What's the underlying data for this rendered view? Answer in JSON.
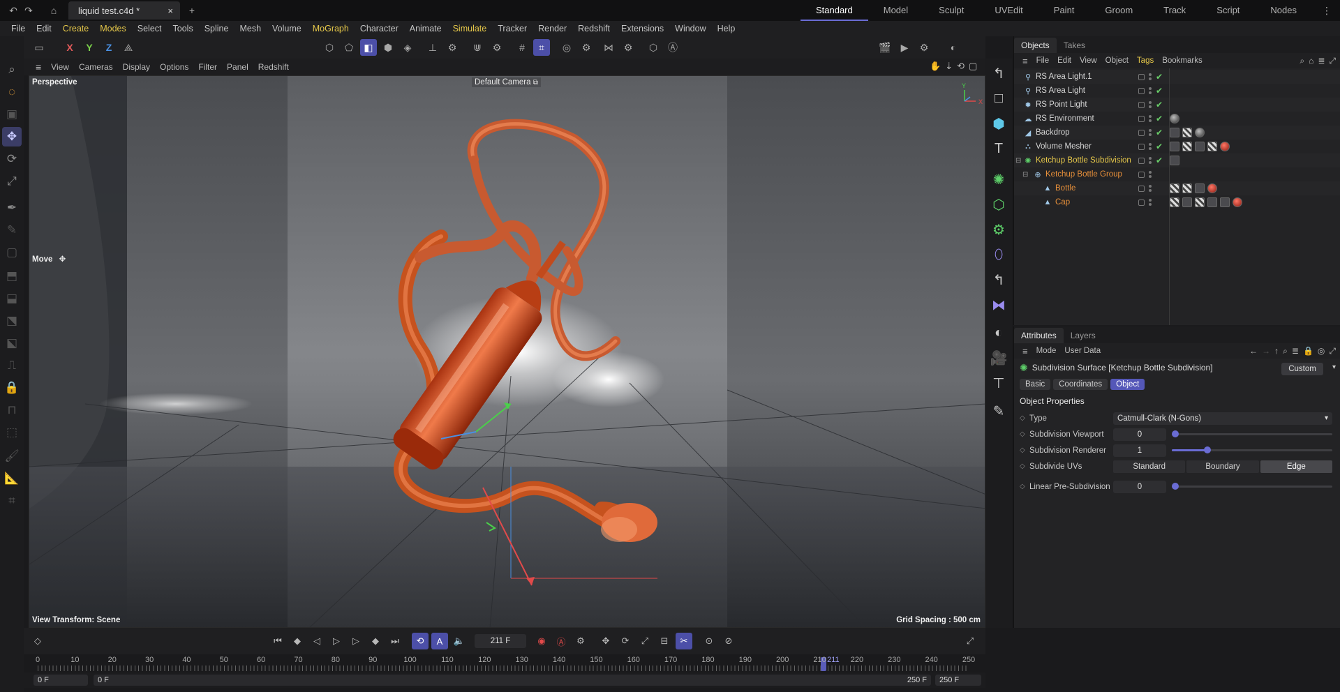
{
  "titlebar": {
    "document_tab": "liquid test.c4d *",
    "close_glyph": "×",
    "new_tab_glyph": "+",
    "layouts": [
      "Standard",
      "Model",
      "Sculpt",
      "UVEdit",
      "Paint",
      "Groom",
      "Track",
      "Script",
      "Nodes"
    ],
    "active_layout": "Standard"
  },
  "menubar": {
    "items": [
      {
        "label": "File",
        "highlight": false
      },
      {
        "label": "Edit",
        "highlight": false
      },
      {
        "label": "Create",
        "highlight": true
      },
      {
        "label": "Modes",
        "highlight": true
      },
      {
        "label": "Select",
        "highlight": false
      },
      {
        "label": "Tools",
        "highlight": false
      },
      {
        "label": "Spline",
        "highlight": false
      },
      {
        "label": "Mesh",
        "highlight": false
      },
      {
        "label": "Volume",
        "highlight": false
      },
      {
        "label": "MoGraph",
        "highlight": true
      },
      {
        "label": "Character",
        "highlight": false
      },
      {
        "label": "Animate",
        "highlight": false
      },
      {
        "label": "Simulate",
        "highlight": true
      },
      {
        "label": "Tracker",
        "highlight": false
      },
      {
        "label": "Render",
        "highlight": false
      },
      {
        "label": "Redshift",
        "highlight": false
      },
      {
        "label": "Extensions",
        "highlight": false
      },
      {
        "label": "Window",
        "highlight": false
      },
      {
        "label": "Help",
        "highlight": false
      }
    ]
  },
  "toolbar": {
    "axis_x": "X",
    "axis_y": "Y",
    "axis_z": "Z"
  },
  "viewport": {
    "menu": [
      "View",
      "Cameras",
      "Display",
      "Options",
      "Filter",
      "Panel",
      "Redshift"
    ],
    "projection": "Perspective",
    "camera": "Default Camera",
    "tool_name": "Move",
    "view_transform": "View Transform: Scene",
    "grid_spacing": "Grid Spacing : 500 cm",
    "axis_y_label": "Y",
    "axis_x_label": "X"
  },
  "objects_panel": {
    "tabs": [
      "Objects",
      "Takes"
    ],
    "menu": [
      {
        "label": "File",
        "highlight": false
      },
      {
        "label": "Edit",
        "highlight": false
      },
      {
        "label": "View",
        "highlight": false
      },
      {
        "label": "Object",
        "highlight": false
      },
      {
        "label": "Tags",
        "highlight": true
      },
      {
        "label": "Bookmarks",
        "highlight": false
      }
    ],
    "objects": [
      {
        "name": "RS Area Light.1",
        "indent": 0,
        "color": "default",
        "icon": "light-icon",
        "checked": true,
        "tags": []
      },
      {
        "name": "RS Area Light",
        "indent": 0,
        "color": "default",
        "icon": "light-icon",
        "checked": true,
        "tags": []
      },
      {
        "name": "RS Point Light",
        "indent": 0,
        "color": "default",
        "icon": "point-light-icon",
        "checked": true,
        "tags": []
      },
      {
        "name": "RS Environment",
        "indent": 0,
        "color": "default",
        "icon": "environment-icon",
        "checked": true,
        "tags": [
          "gray"
        ]
      },
      {
        "name": "Backdrop",
        "indent": 0,
        "color": "default",
        "icon": "backdrop-icon",
        "checked": true,
        "tags": [
          "plain",
          "checker",
          "gray"
        ]
      },
      {
        "name": "Volume Mesher",
        "indent": 0,
        "color": "default",
        "icon": "volume-mesher-icon",
        "checked": true,
        "tags": [
          "plain",
          "checker",
          "plain",
          "checker",
          "red"
        ]
      },
      {
        "name": "Ketchup Bottle Subdivision",
        "indent": 0,
        "color": "yellow",
        "icon": "subdivision-icon",
        "checked": true,
        "tags": [
          "plain"
        ]
      },
      {
        "name": "Ketchup Bottle Group",
        "indent": 1,
        "color": "orange",
        "icon": "null-icon",
        "checked": false,
        "tags": []
      },
      {
        "name": "Bottle",
        "indent": 2,
        "color": "orange",
        "icon": "polygon-icon",
        "checked": false,
        "tags": [
          "checker",
          "checker",
          "plain",
          "red"
        ]
      },
      {
        "name": "Cap",
        "indent": 2,
        "color": "orange",
        "icon": "polygon-icon",
        "checked": false,
        "tags": [
          "checker",
          "plain",
          "checker",
          "plain",
          "plain",
          "red"
        ]
      }
    ]
  },
  "attributes_panel": {
    "tabs": [
      "Attributes",
      "Layers"
    ],
    "menu": [
      "Mode",
      "User Data"
    ],
    "object_title": "Subdivision Surface [Ketchup Bottle Subdivision]",
    "preset": "Custom",
    "sub_tabs": [
      "Basic",
      "Coordinates",
      "Object"
    ],
    "active_sub_tab": "Object",
    "section": "Object Properties",
    "type_label": "Type",
    "type_value": "Catmull-Clark (N-Gons)",
    "viewport_label": "Subdivision Viewport",
    "viewport_value": "0",
    "viewport_fraction": 0.0,
    "renderer_label": "Subdivision Renderer",
    "renderer_value": "1",
    "renderer_fraction": 0.22,
    "uvs_label": "Subdivide UVs",
    "uvs_options": [
      "Standard",
      "Boundary",
      "Edge"
    ],
    "uvs_active": "Edge",
    "linear_label": "Linear Pre-Subdivision",
    "linear_value": "0",
    "linear_fraction": 0.0
  },
  "timeline": {
    "current_frame": "211 F",
    "ticks": [
      "0",
      "10",
      "20",
      "30",
      "40",
      "50",
      "60",
      "70",
      "80",
      "90",
      "100",
      "110",
      "120",
      "130",
      "140",
      "150",
      "160",
      "170",
      "180",
      "190",
      "200",
      "210",
      "220",
      "230",
      "240",
      "250"
    ],
    "playhead_frame": 211,
    "playhead_label": "211",
    "frame_max": 250,
    "range_start": "0 F",
    "range_preview_start": "0 F",
    "range_preview_end": "250 F",
    "range_end": "250 F"
  },
  "colors": {
    "accent": "#6a6cd4",
    "highlight_yellow": "#e6c84a",
    "child_orange": "#e8903a",
    "enabled_green": "#6ad06a"
  }
}
